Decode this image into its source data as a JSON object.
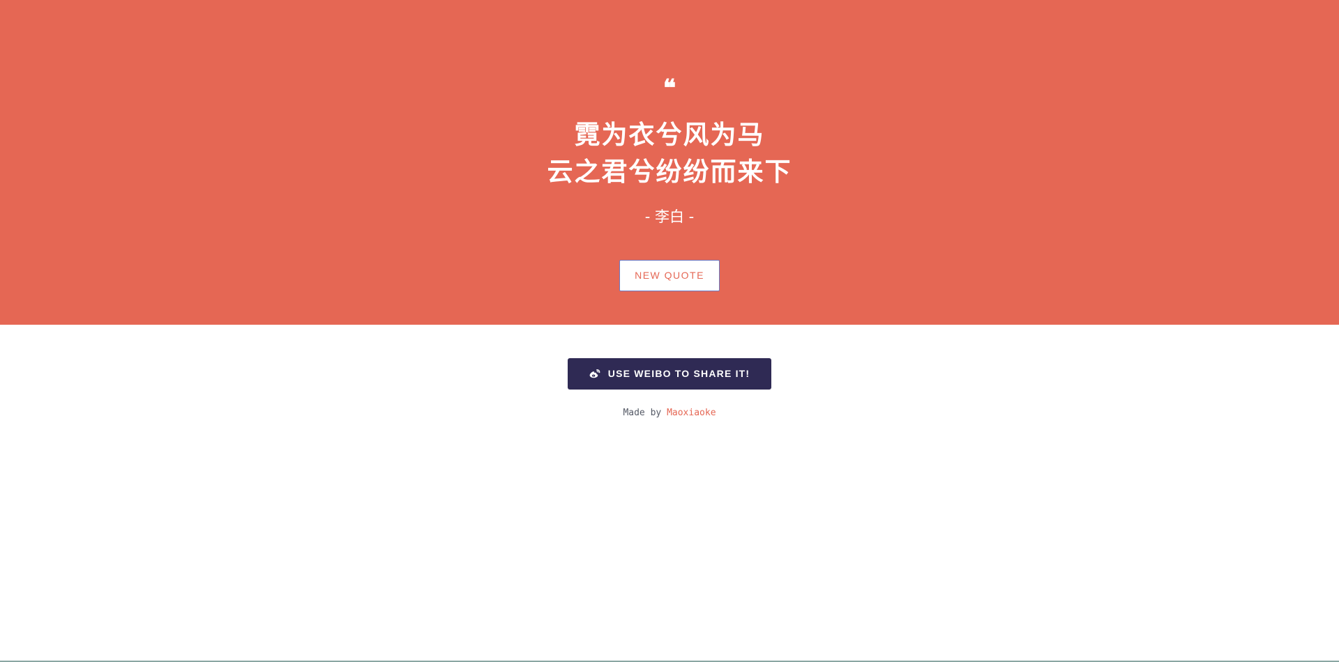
{
  "hero": {
    "background_color": "#e56754",
    "quote_icon": "quote-left-icon",
    "quote_mark": "❝",
    "quote_lines": [
      "霓为衣兮风为马",
      "云之君兮纷纷而来下"
    ],
    "author": "- 李白 -",
    "new_quote_label": "NEW QUOTE"
  },
  "share": {
    "icon": "weibo-icon",
    "label": "USE WEIBO TO SHARE IT!",
    "background_color": "#2f2a54"
  },
  "footer": {
    "made_by_label": "Made by",
    "author_link": "Maoxiaoke"
  }
}
